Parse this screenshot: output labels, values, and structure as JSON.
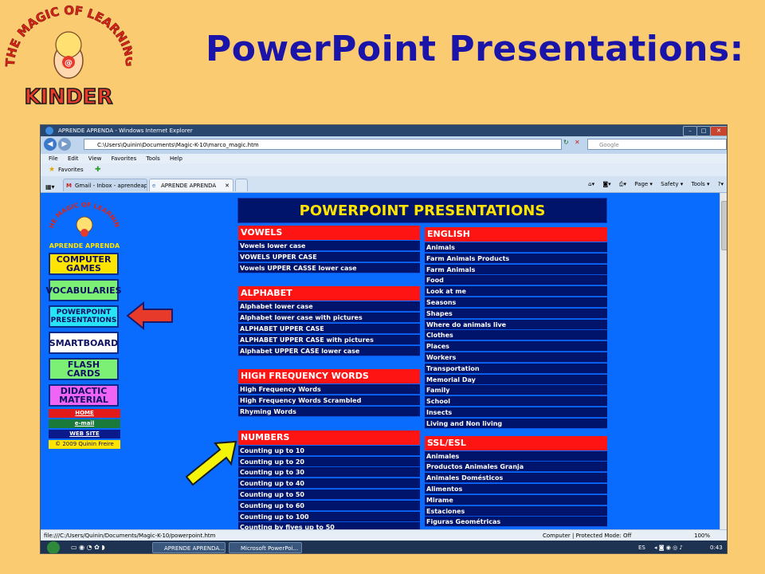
{
  "slide": {
    "title": "PowerPoint Presentations:",
    "logo_top_text": "THE MAGIC OF LEARNING",
    "logo_bottom_text": "KINDER"
  },
  "browser": {
    "window_title": "APRENDE APRENDA - Windows Internet Explorer",
    "address": "C:\\Users\\Quinin\\Documents\\Magic-K-10\\marco_magic.htm",
    "search_placeholder": "Google",
    "menu": [
      "File",
      "Edit",
      "View",
      "Favorites",
      "Tools",
      "Help"
    ],
    "favorites_label": "Favorites",
    "tabs": [
      {
        "label": "Gmail - Inbox - aprendeap..."
      },
      {
        "label": "APRENDE APRENDA"
      }
    ],
    "tab_close": "✕",
    "command_bar": [
      "Page ▾",
      "Safety ▾",
      "Tools ▾"
    ],
    "status_url": "file:///C:/Users/Quinin/Documents/Magic-K-10/powerpoint.htm",
    "status_zone": "Computer | Protected Mode: Off",
    "zoom": "100%"
  },
  "sidebar": {
    "logo_top_text": "THE MAGIC OF LEARNING",
    "logo_bottom_text": "APRENDE APRENDA",
    "buttons": [
      {
        "label": "COMPUTER GAMES",
        "bg": "#FFE400"
      },
      {
        "label": "VOCABULARIES",
        "bg": "#7CF075"
      },
      {
        "label": "POWERPOINT PRESENTATIONS",
        "bg": "#27E4F7"
      },
      {
        "label": "SMARTBOARD",
        "bg": "#FFFFFF"
      },
      {
        "label": "FLASH CARDS",
        "bg": "#7CF075"
      },
      {
        "label": "DIDACTIC MATERIAL",
        "bg": "#F064F5"
      }
    ],
    "links": [
      {
        "label": "HOME",
        "bg": "#E21A1A"
      },
      {
        "label": "e-mail",
        "bg": "#1A7A3A"
      },
      {
        "label": "WEB SITE",
        "bg": "#0A1A8A"
      }
    ],
    "copyright": "© 2009 Quinin Freire"
  },
  "table": {
    "header": "POWERPOINT PRESENTATIONS",
    "left_sections": [
      {
        "title": "VOWELS",
        "items": [
          "Vowels lower case",
          "VOWELS UPPER CASE",
          "Vowels UPPER CASSE lower case"
        ]
      },
      {
        "title": "ALPHABET",
        "items": [
          "Alphabet lower case",
          "Alphabet lower case with pictures",
          "ALPHABET UPPER CASE",
          "ALPHABET UPPER CASE with pictures",
          "Alphabet UPPER CASE lower case"
        ]
      },
      {
        "title": "HIGH FREQUENCY WORDS",
        "items": [
          "High Frequency Words",
          "High Frequency Words Scrambled",
          "Rhyming Words"
        ]
      },
      {
        "title": "NUMBERS",
        "items": [
          "Counting up to 10",
          "Counting up to 20",
          "Counting up to 30",
          "Counting up to 40",
          "Counting up to 50",
          "Counting up to 60",
          "Counting up to 100",
          "Counting by fives up to 50"
        ]
      }
    ],
    "right_sections": [
      {
        "title": "ENGLISH",
        "items": [
          "Animals",
          "Farm Animals Products",
          "Farm Animals",
          "Food",
          "Look at me",
          "Seasons",
          "Shapes",
          "Where do animals live",
          "Clothes",
          "Places",
          "Workers",
          "Transportation",
          "Memorial Day",
          "Family",
          "School",
          "Insects",
          "Living and Non living"
        ]
      },
      {
        "title": "SSL/ESL",
        "items": [
          "Animales",
          "Productos Animales Granja",
          "Animales Domésticos",
          "Alimentos",
          "Mirame",
          "Estaciones",
          "Figuras Geométricas"
        ]
      }
    ]
  },
  "taskbar": {
    "items": [
      {
        "label": "APRENDE APRENDA..."
      },
      {
        "label": "Microsoft PowerPoi..."
      }
    ],
    "language": "ES",
    "clock": "0:43"
  },
  "colors": {
    "slide_bg": "#FBCB72",
    "title_color": "#1A15A8",
    "page_bg": "#0A6BFF",
    "table_header_bg": "#00146B",
    "table_header_text": "#FFE400",
    "section_bg": "#FF1414",
    "arrow_red": "#E83A2A",
    "arrow_yellow": "#F4F40A"
  }
}
